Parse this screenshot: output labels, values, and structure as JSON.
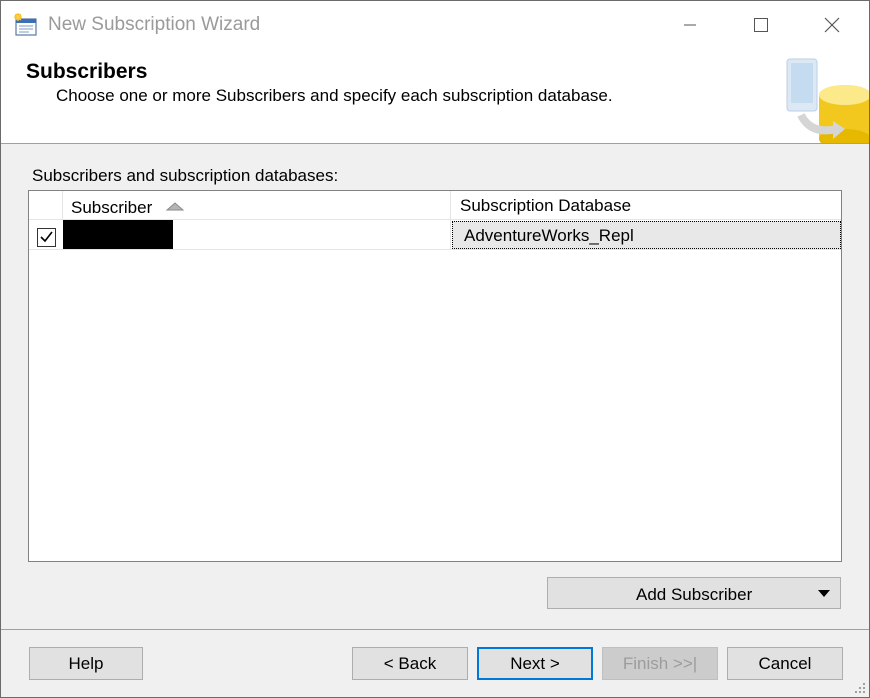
{
  "window": {
    "title": "New Subscription Wizard"
  },
  "header": {
    "title": "Subscribers",
    "subtitle": "Choose one or more Subscribers and specify each subscription database."
  },
  "grid": {
    "label": "Subscribers and subscription databases:",
    "columns": {
      "subscriber": "Subscriber",
      "database": "Subscription Database"
    },
    "rows": [
      {
        "checked": true,
        "subscriber": "",
        "database": "AdventureWorks_Repl"
      }
    ]
  },
  "add_subscriber": {
    "label": "Add Subscriber"
  },
  "buttons": {
    "help": "Help",
    "back": "< Back",
    "next": "Next >",
    "finish": "Finish >>|",
    "cancel": "Cancel"
  },
  "colors": {
    "accent": "#0078d7",
    "dialog_bg": "#f0f0f0"
  }
}
